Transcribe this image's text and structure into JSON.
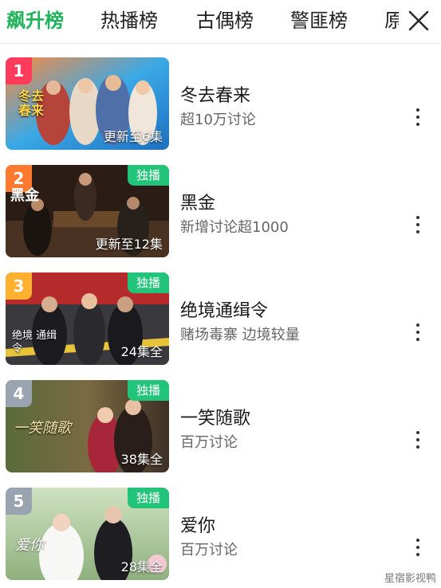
{
  "tabs": [
    {
      "label": "飙升榜",
      "active": true
    },
    {
      "label": "热播榜",
      "active": false
    },
    {
      "label": "古偶榜",
      "active": false
    },
    {
      "label": "警匪榜",
      "active": false
    },
    {
      "label": "原",
      "active": false
    }
  ],
  "close_icon": "close-icon",
  "items": [
    {
      "rank": "1",
      "title": "冬去春来",
      "desc": "超10万讨论",
      "badge": "",
      "episode": "更新至6集",
      "poster_text": "冬去春来",
      "rank_color": "#ff3b5c"
    },
    {
      "rank": "2",
      "title": "黑金",
      "desc": "新增讨论超1000",
      "badge": "独播",
      "episode": "更新至12集",
      "poster_text": "黑金",
      "rank_color": "#ff7a2e"
    },
    {
      "rank": "3",
      "title": "绝境通缉令",
      "desc": "赌场毒寨 边境较量",
      "badge": "独播",
      "episode": "24集全",
      "poster_text": "绝境 通缉令",
      "rank_color": "#ffb02e"
    },
    {
      "rank": "4",
      "title": "一笑随歌",
      "desc": "百万讨论",
      "badge": "独播",
      "episode": "38集全",
      "poster_text": "一笑随歌",
      "rank_color": "#9aa3b0"
    },
    {
      "rank": "5",
      "title": "爱你",
      "desc": "百万讨论",
      "badge": "独播",
      "episode": "28集全",
      "poster_text": "爱你",
      "rank_color": "#9aa3b0"
    }
  ],
  "watermark": "星宿影视鸭"
}
